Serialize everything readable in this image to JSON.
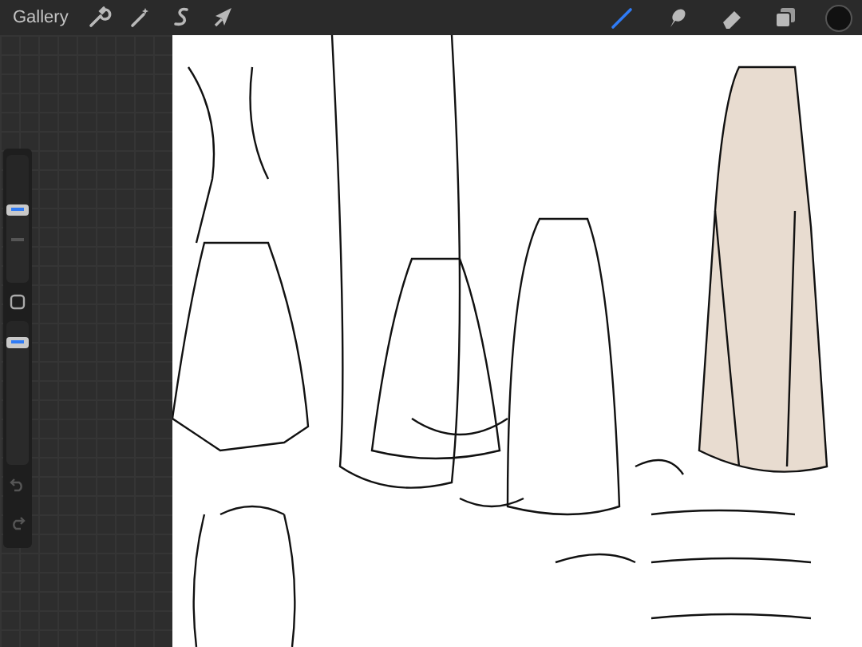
{
  "top_bar": {
    "gallery_label": "Gallery",
    "tools": [
      {
        "kind": "brush",
        "selected": true
      },
      {
        "kind": "smudge",
        "selected": false
      },
      {
        "kind": "eraser",
        "selected": false
      }
    ]
  },
  "sidebar": {
    "size_slider": {
      "level": 0.58
    },
    "opacity_slider": {
      "level": 0.86
    }
  }
}
